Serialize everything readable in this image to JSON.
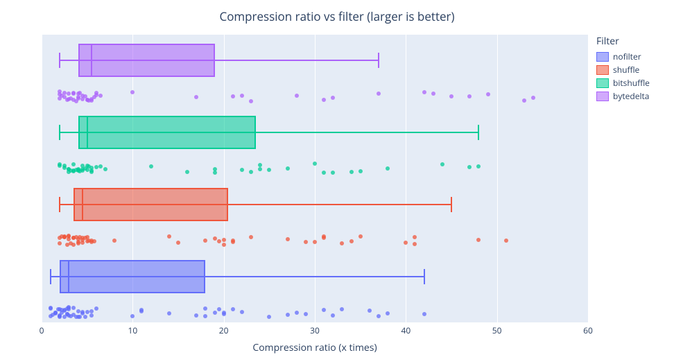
{
  "chart_data": {
    "type": "boxplot",
    "title": "Compression ratio vs filter (larger is better)",
    "xlabel": "Compression ratio (x times)",
    "ylabel": "",
    "xlim": [
      0,
      60
    ],
    "x_ticks": [
      0,
      10,
      20,
      30,
      40,
      50,
      60
    ],
    "legend_title": "Filter",
    "series": [
      {
        "name": "nofilter",
        "color_line": "#636efa",
        "color_fill": "rgba(99,110,250,0.55)",
        "box": {
          "whisker_low": 1,
          "q1": 2,
          "median": 3,
          "q3": 18,
          "whisker_high": 42
        },
        "points": [
          1,
          1,
          1,
          1.2,
          1.5,
          1.5,
          1.5,
          1.8,
          2,
          2,
          2,
          2,
          2.2,
          2.2,
          2.5,
          2.5,
          2.5,
          2.8,
          2.8,
          2.8,
          3,
          3,
          3,
          3,
          3.2,
          3.5,
          3.5,
          3.8,
          4,
          4,
          4.2,
          4.5,
          4.5,
          4.8,
          5,
          5.5,
          5.5,
          6,
          10,
          11,
          11,
          14,
          17,
          18,
          18,
          19,
          19.5,
          20,
          20,
          21,
          22,
          25,
          27,
          28,
          29,
          31,
          32,
          33,
          36,
          37,
          38,
          42
        ]
      },
      {
        "name": "shuffle",
        "color_line": "#ef553b",
        "color_fill": "rgba(239,85,59,0.55)",
        "box": {
          "whisker_low": 2,
          "q1": 3.5,
          "median": 4.5,
          "q3": 20.5,
          "whisker_high": 45
        },
        "points": [
          2,
          2,
          2.2,
          2.5,
          2.5,
          2.5,
          2.8,
          3,
          3,
          3,
          3.2,
          3.5,
          3.5,
          3.5,
          3.8,
          4,
          4,
          4,
          4.2,
          4.5,
          4.5,
          4.5,
          4.8,
          5,
          5,
          5.2,
          5.5,
          5.5,
          5.8,
          8,
          14,
          15,
          18,
          19,
          19.5,
          20,
          20,
          21,
          21,
          23,
          27,
          29,
          30,
          31,
          31,
          33,
          34,
          35,
          40,
          41,
          41,
          48,
          51
        ]
      },
      {
        "name": "bitshuffle",
        "color_line": "#00cc96",
        "color_fill": "rgba(0,204,150,0.55)",
        "box": {
          "whisker_low": 2,
          "q1": 4,
          "median": 5,
          "q3": 23.5,
          "whisker_high": 48
        },
        "points": [
          2,
          2,
          2.5,
          2.5,
          3,
          3,
          3,
          3.2,
          3.5,
          3.5,
          3.5,
          3.8,
          4,
          4,
          4,
          4.2,
          4.5,
          4.5,
          4.5,
          4.8,
          5,
          5,
          5.2,
          5.5,
          5.5,
          5.5,
          6,
          6.5,
          7,
          12,
          16,
          19,
          19,
          22,
          23,
          24,
          24,
          25,
          27,
          30,
          31,
          32,
          34,
          35,
          38,
          44,
          47,
          48
        ]
      },
      {
        "name": "bytedelta",
        "color_line": "#ab63fa",
        "color_fill": "rgba(171,99,250,0.55)",
        "box": {
          "whisker_low": 2,
          "q1": 4,
          "median": 5.5,
          "q3": 19,
          "whisker_high": 37
        },
        "points": [
          2,
          2,
          2,
          2.2,
          2.5,
          2.5,
          2.8,
          3,
          3,
          3.2,
          3.5,
          3.5,
          3.5,
          3.8,
          4,
          4,
          4,
          4.2,
          4.5,
          4.5,
          4.8,
          5,
          5,
          5.2,
          5.5,
          5.5,
          5.8,
          6,
          6,
          6.5,
          10,
          17,
          21,
          22,
          23,
          28,
          31,
          32,
          37,
          42,
          43,
          45,
          47,
          49,
          53,
          54
        ]
      }
    ]
  }
}
